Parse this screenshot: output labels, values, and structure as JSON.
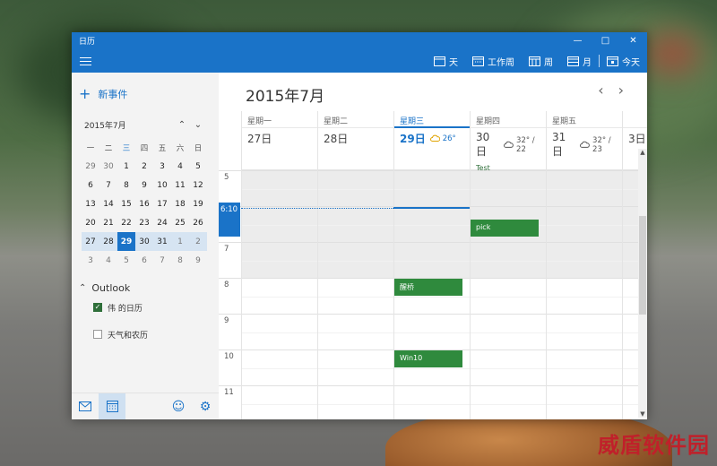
{
  "window": {
    "title": "日历"
  },
  "toolbar": {
    "views": [
      {
        "label": "天"
      },
      {
        "label": "工作周"
      },
      {
        "label": "周"
      },
      {
        "label": "月"
      },
      {
        "label": "今天"
      }
    ]
  },
  "sidebar": {
    "new_event": "新事件",
    "mini_calendar": {
      "title": "2015年7月",
      "weekdays": [
        "一",
        "二",
        "三",
        "四",
        "五",
        "六",
        "日"
      ],
      "selected_weekday_index": 2,
      "weeks": [
        [
          "29",
          "30",
          "1",
          "2",
          "3",
          "4",
          "5"
        ],
        [
          "6",
          "7",
          "8",
          "9",
          "10",
          "11",
          "12"
        ],
        [
          "13",
          "14",
          "15",
          "16",
          "17",
          "18",
          "19"
        ],
        [
          "20",
          "21",
          "22",
          "23",
          "24",
          "25",
          "26"
        ],
        [
          "27",
          "28",
          "29",
          "30",
          "31",
          "1",
          "2"
        ],
        [
          "3",
          "4",
          "5",
          "6",
          "7",
          "8",
          "9"
        ]
      ],
      "selected_week_index": 4,
      "today_day_index": 2
    },
    "account": "Outlook",
    "calendars": [
      {
        "label": "伟 的日历",
        "checked": true
      },
      {
        "label": "天气和农历",
        "checked": false
      }
    ]
  },
  "main": {
    "month_title": "2015年7月",
    "days": [
      {
        "dow": "星期一",
        "date": "27日",
        "weather": "",
        "allday": ""
      },
      {
        "dow": "星期二",
        "date": "28日",
        "weather": "",
        "allday": ""
      },
      {
        "dow": "星期三",
        "date": "29日",
        "weather": "26°",
        "allday": "",
        "today": true
      },
      {
        "dow": "星期四",
        "date": "30日",
        "weather": "32° / 22",
        "allday": "Test"
      },
      {
        "dow": "星期五",
        "date": "31日",
        "weather": "32° / 23",
        "allday": ""
      },
      {
        "dow": "",
        "date": "3日",
        "weather": "",
        "allday": ""
      }
    ],
    "hours": [
      "5",
      "6",
      "7",
      "8",
      "9",
      "10",
      "11"
    ],
    "now_label": "6:10",
    "events": [
      {
        "title": "pick",
        "day": 3,
        "start_hour": 6.35
      },
      {
        "title": "醒桥",
        "day": 2,
        "start_hour": 8.0
      },
      {
        "title": "Win10",
        "day": 2,
        "start_hour": 10.0
      }
    ]
  },
  "watermark": "威盾软件园",
  "colors": {
    "accent": "#1a73c8",
    "event": "#2f8a3d"
  }
}
